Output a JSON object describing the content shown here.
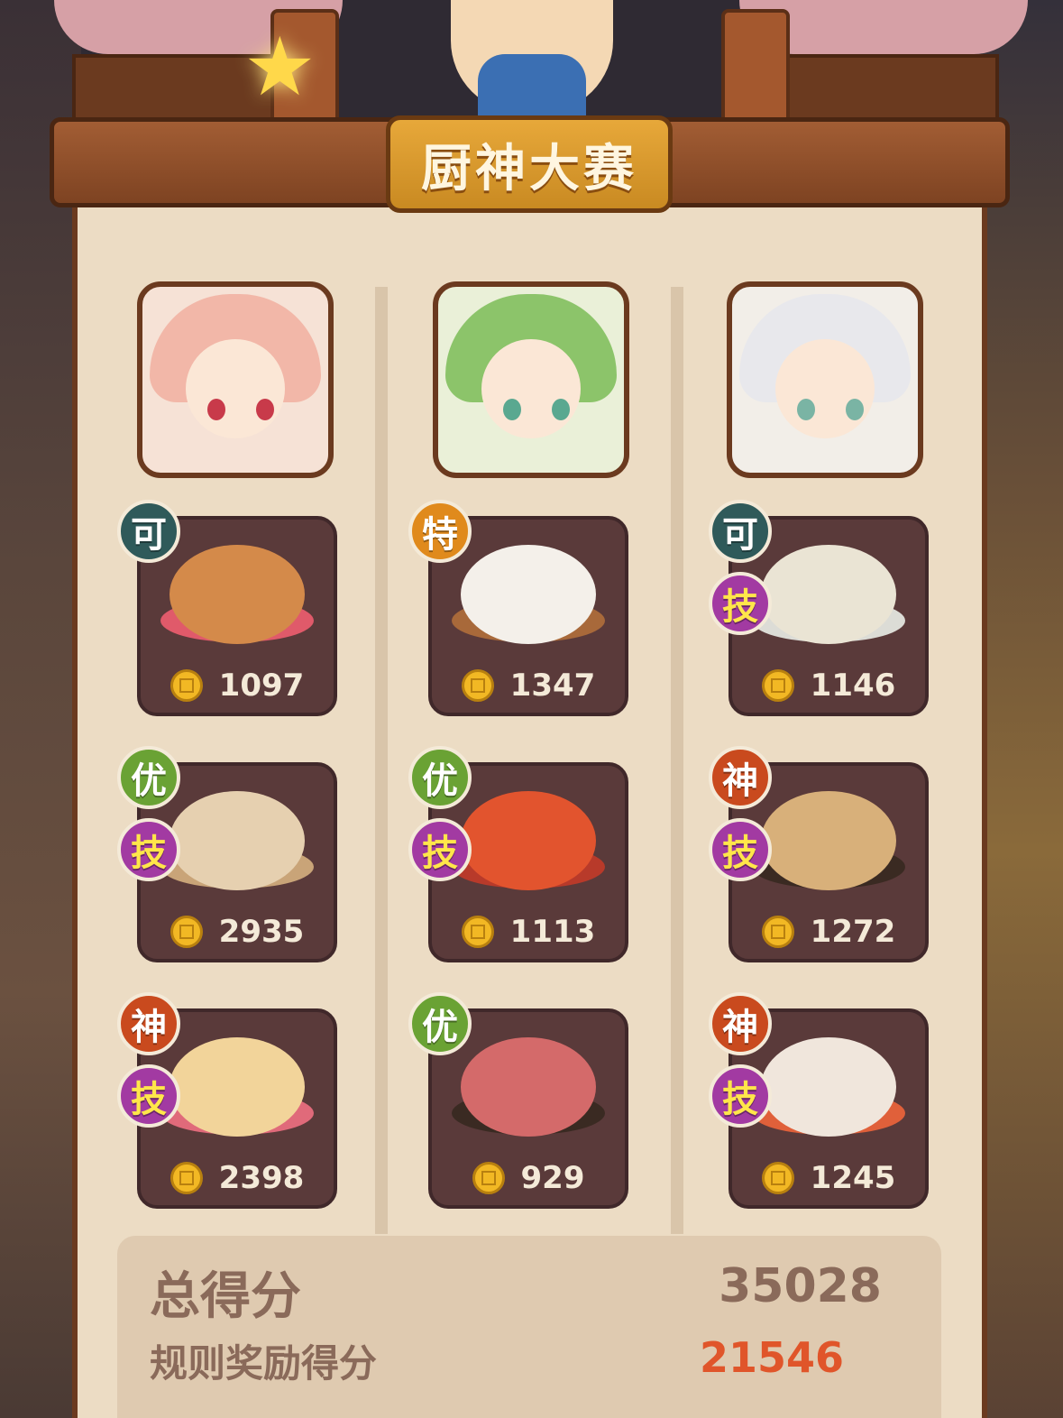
{
  "title": "厨神大赛",
  "chefs": [
    {
      "name": "pink-haired-chef"
    },
    {
      "name": "green-haired-chef"
    },
    {
      "name": "white-haired-chef"
    }
  ],
  "dishes": [
    {
      "grade": "可",
      "skill": "",
      "score": "1097"
    },
    {
      "grade": "特",
      "skill": "",
      "score": "1347"
    },
    {
      "grade": "可",
      "skill": "技",
      "score": "1146"
    },
    {
      "grade": "优",
      "skill": "技",
      "score": "2935"
    },
    {
      "grade": "优",
      "skill": "技",
      "score": "1113"
    },
    {
      "grade": "神",
      "skill": "技",
      "score": "1272"
    },
    {
      "grade": "神",
      "skill": "技",
      "score": "2398"
    },
    {
      "grade": "优",
      "skill": "",
      "score": "929"
    },
    {
      "grade": "神",
      "skill": "技",
      "score": "1245"
    }
  ],
  "totals": {
    "total_label": "总得分",
    "total_value": "35028",
    "bonus_label": "规则奖励得分",
    "bonus_value": "21546"
  },
  "colors": {
    "card": "#5a3a3a",
    "panel": "#ecdcc4",
    "title_plaque": "#e7a83a",
    "bonus_value": "#e0552a"
  }
}
